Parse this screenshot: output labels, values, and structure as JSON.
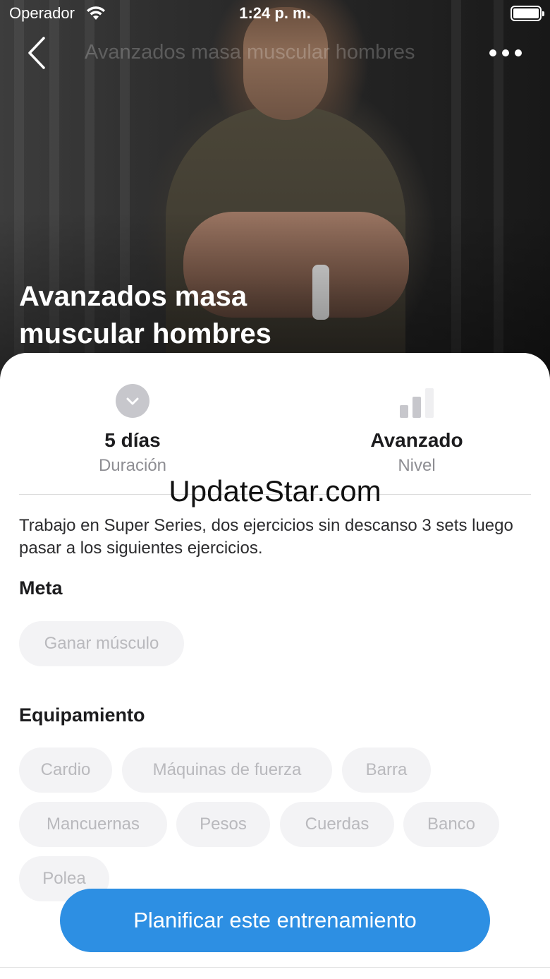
{
  "status_bar": {
    "carrier": "Operador",
    "time": "1:24 p. m."
  },
  "nav": {
    "title": "Avanzados masa muscular hombres"
  },
  "hero": {
    "title": "Avanzados masa muscular hombres"
  },
  "stats": {
    "duration": {
      "value": "5 días",
      "label": "Duración",
      "icon": "clock-icon"
    },
    "level": {
      "value": "Avanzado",
      "label": "Nivel",
      "icon": "signal-bars-icon"
    }
  },
  "watermark": "UpdateStar.com",
  "description": "Trabajo en Super Series, dos ejercicios sin descanso 3 sets luego pasar a los siguientes ejercicios.",
  "goal": {
    "title": "Meta",
    "chips": [
      "Ganar músculo"
    ]
  },
  "equipment": {
    "title": "Equipamiento",
    "chips": [
      "Cardio",
      "Máquinas de fuerza",
      "Barra",
      "Mancuernas",
      "Pesos",
      "Cuerdas",
      "Banco",
      "Polea"
    ]
  },
  "cta": {
    "label": "Planificar este entrenamiento"
  },
  "colors": {
    "accent": "#2d8fe3",
    "chip_bg": "#f3f3f5",
    "chip_text": "#b9b9bd"
  }
}
